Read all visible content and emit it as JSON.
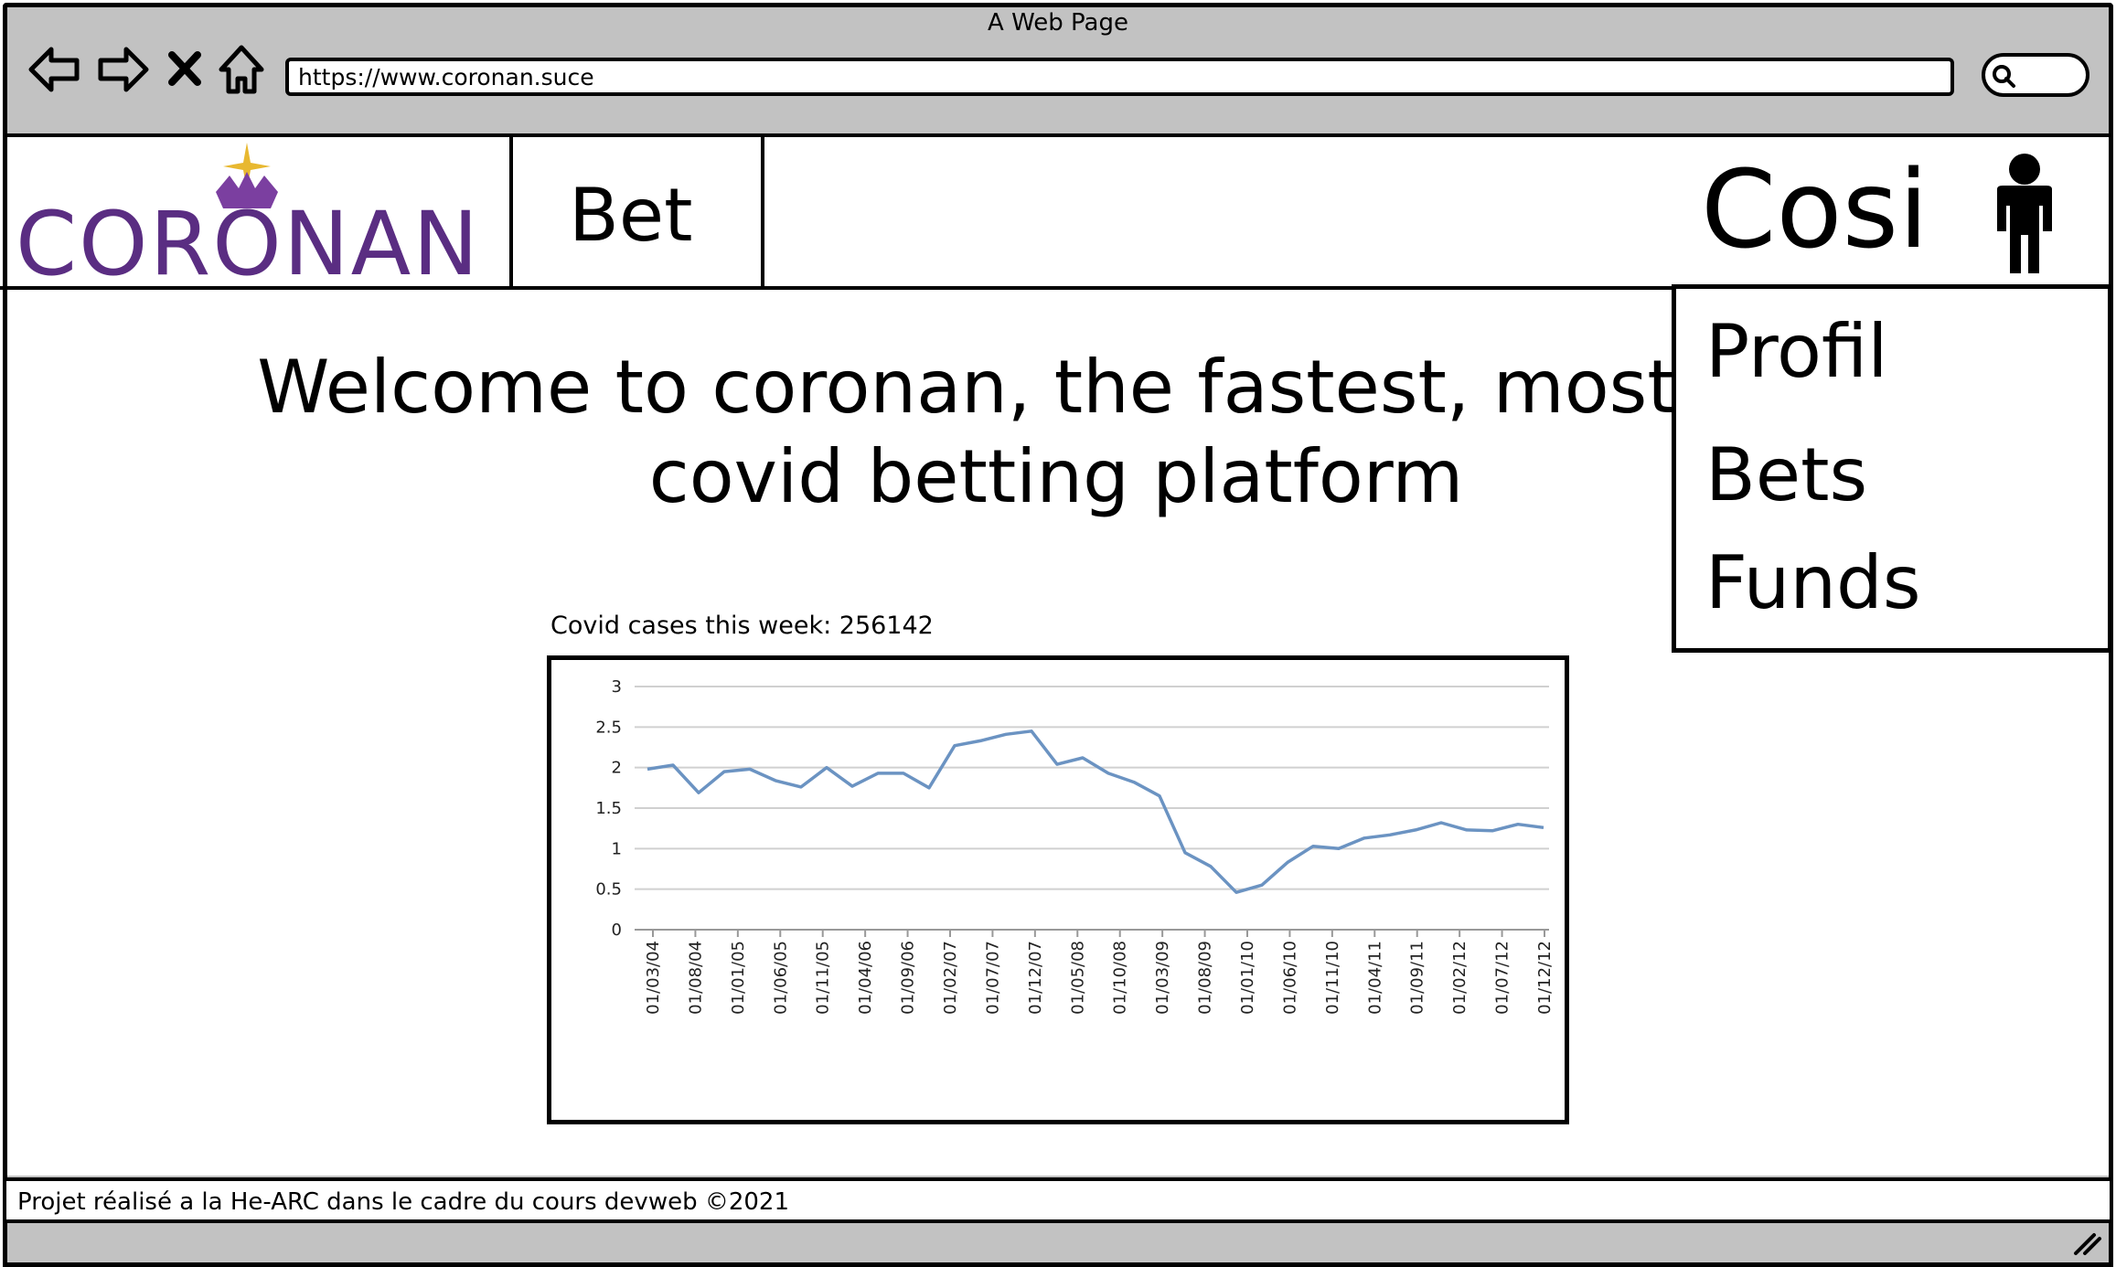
{
  "window": {
    "title": "A Web Page",
    "url": "https://www.coronan.suce"
  },
  "header": {
    "logo_text": "CORONAN",
    "nav_bet": "Bet",
    "user_name": "Cosi"
  },
  "welcome": {
    "text": "Welcome to coronan, the fastest, most effic covid betting platform"
  },
  "chart": {
    "caption": "Covid cases this week:  256142"
  },
  "chart_data": {
    "type": "line",
    "title": "",
    "xlabel": "",
    "ylabel": "",
    "ylim": [
      0,
      3
    ],
    "yticks": [
      "0",
      "0.5",
      "1",
      "1.5",
      "2",
      "2.5",
      "3"
    ],
    "xtick_labels": [
      "01/03/04",
      "01/08/04",
      "01/01/05",
      "01/06/05",
      "01/11/05",
      "01/04/06",
      "01/09/06",
      "01/02/07",
      "01/07/07",
      "01/12/07",
      "01/05/08",
      "01/10/08",
      "01/03/09",
      "01/08/09",
      "01/01/10",
      "01/06/10",
      "01/11/10",
      "01/04/11",
      "01/09/11",
      "01/02/12",
      "01/07/12",
      "01/12/12"
    ],
    "grid": true,
    "legend": "none",
    "series_color": "#6b93c2",
    "values": [
      1.98,
      2.03,
      1.69,
      1.95,
      1.98,
      1.84,
      1.76,
      2.0,
      1.77,
      1.93,
      1.93,
      1.75,
      2.27,
      2.33,
      2.41,
      2.45,
      2.04,
      2.12,
      1.93,
      1.82,
      1.65,
      0.95,
      0.78,
      0.46,
      0.55,
      0.83,
      1.03,
      1.0,
      1.13,
      1.17,
      1.23,
      1.32,
      1.23,
      1.22,
      1.3,
      1.26
    ]
  },
  "user_menu": {
    "items": [
      "Profil",
      "Bets",
      "Funds"
    ]
  },
  "footer": {
    "text": "Projet réalisé a la He-ARC dans le cadre du cours devweb ©2021"
  }
}
